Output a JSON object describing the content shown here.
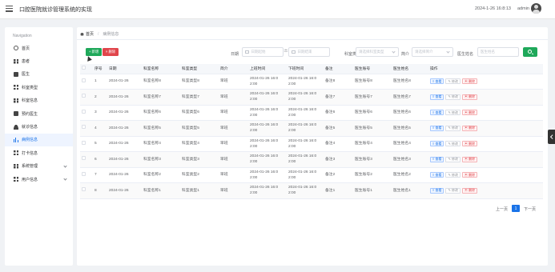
{
  "app": {
    "title": "口腔医院就诊管理系统的实现",
    "datetime": "2024-1-26 16:8:13",
    "username": "admin"
  },
  "sidebar": {
    "title": "Navigation",
    "items": [
      {
        "label": "首页",
        "icon": "home-icon"
      },
      {
        "label": "患者",
        "icon": "grid-icon"
      },
      {
        "label": "医生",
        "icon": "doc-icon"
      },
      {
        "label": "科室类型",
        "icon": "grid-icon"
      },
      {
        "label": "科室信息",
        "icon": "grid-icon"
      },
      {
        "label": "预约医生",
        "icon": "doc-icon"
      },
      {
        "label": "就诊信息",
        "icon": "user-icon"
      },
      {
        "label": "病例信息",
        "icon": "bar-chart-icon",
        "active": true
      },
      {
        "label": "打卡信息",
        "icon": "grid-icon"
      },
      {
        "label": "系统管理",
        "icon": "grid-icon",
        "expandable": true
      },
      {
        "label": "用户信息",
        "icon": "grid-icon",
        "expandable": true
      }
    ]
  },
  "breadcrumb": {
    "home": "首页",
    "current": "病例信息"
  },
  "toolbar": {
    "add_label": "+ 新增",
    "delete_label": "× 删除"
  },
  "filters": {
    "date_label": "日期",
    "date_start_placeholder": "日期起始",
    "date_end_placeholder": "日期结束",
    "dept_label": "科室类型",
    "dept_placeholder": "请选择科室类型",
    "status_label": "简介",
    "status_placeholder": "请选择简介",
    "doctor_label": "医生姓名",
    "doctor_placeholder": "医生姓名"
  },
  "table": {
    "headers": [
      "",
      "序号",
      "日期",
      "科室名称",
      "科室类型",
      "简介",
      "上班时间",
      "下班时间",
      "备注",
      "医生账号",
      "医生姓名",
      "操作"
    ],
    "actions": {
      "view": "≡ 查看",
      "edit": "✎ 修改",
      "delete": "▣ 删除"
    },
    "rows": [
      [
        "1",
        "2024-01-26",
        "科室名称8",
        "科室类型8",
        "早班",
        "2024-01-26 16:0\n2:00",
        "2024-01-26 16:0\n2:00",
        "备注8",
        "医生账号8",
        "医生姓名8"
      ],
      [
        "2",
        "2024-01-26",
        "科室名称7",
        "科室类型7",
        "早班",
        "2024-01-26 16:0\n2:00",
        "2024-01-26 16:0\n2:00",
        "备注7",
        "医生账号7",
        "医生姓名7"
      ],
      [
        "3",
        "2024-01-26",
        "科室名称6",
        "科室类型6",
        "早班",
        "2024-01-26 16:0\n2:00",
        "2024-01-26 16:0\n2:00",
        "备注6",
        "医生账号6",
        "医生姓名6"
      ],
      [
        "4",
        "2024-01-26",
        "科室名称5",
        "科室类型5",
        "早班",
        "2024-01-26 16:0\n2:00",
        "2024-01-26 16:0\n2:00",
        "备注5",
        "医生账号5",
        "医生姓名5"
      ],
      [
        "5",
        "2024-01-26",
        "科室名称4",
        "科室类型4",
        "早班",
        "2024-01-26 16:0\n2:00",
        "2024-01-26 16:0\n2:00",
        "备注4",
        "医生账号4",
        "医生姓名4"
      ],
      [
        "6",
        "2024-01-26",
        "科室名称3",
        "科室类型3",
        "早班",
        "2024-01-26 16:0\n2:00",
        "2024-01-26 16:0\n2:00",
        "备注3",
        "医生账号3",
        "医生姓名3"
      ],
      [
        "7",
        "2024-01-26",
        "科室名称2",
        "科室类型2",
        "早班",
        "2024-01-26 16:0\n2:00",
        "2024-01-26 16:0\n2:00",
        "备注2",
        "医生账号2",
        "医生姓名2"
      ],
      [
        "8",
        "2024-01-26",
        "科室名称1",
        "科室类型1",
        "早班",
        "2024-01-26 16:0\n2:00",
        "2024-01-26 16:0\n2:00",
        "备注1",
        "医生账号1",
        "医生姓名1"
      ]
    ]
  },
  "pagination": {
    "prev": "上一页",
    "current": "1",
    "next": "下一页"
  },
  "colors": {
    "primary": "#1a73e8",
    "success": "#1fa85a",
    "danger": "#e0454b"
  }
}
